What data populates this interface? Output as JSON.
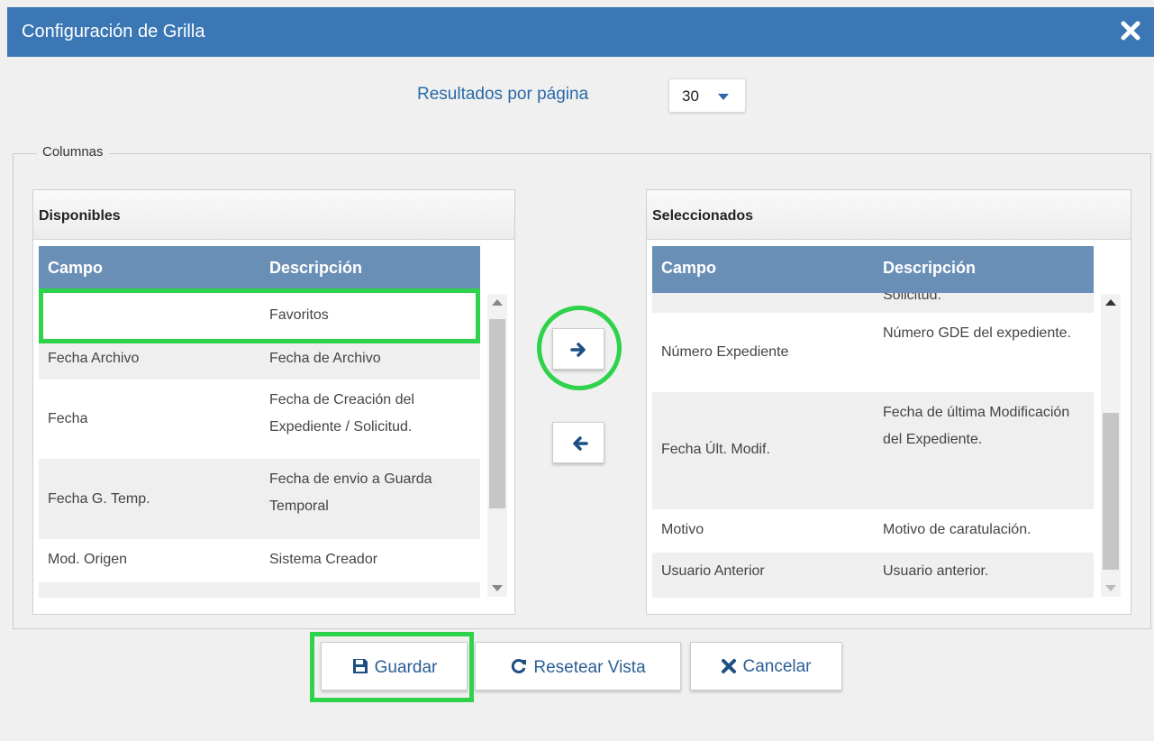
{
  "dialog": {
    "title": "Configuración de Grilla",
    "close_icon": "close-icon"
  },
  "results_per_page": {
    "label": "Resultados por página",
    "value": "30"
  },
  "columns": {
    "legend": "Columnas",
    "available": {
      "title": "Disponibles",
      "headers": [
        "Campo",
        "Descripción"
      ],
      "rows": [
        {
          "campo": "",
          "descripcion": "Favoritos"
        },
        {
          "campo": "Fecha Archivo",
          "descripcion": "Fecha de Archivo"
        },
        {
          "campo": "Fecha",
          "descripcion": "Fecha de Creación del Expediente / Solicitud."
        },
        {
          "campo": "Fecha G. Temp.",
          "descripcion": "Fecha de envio a Guarda Temporal"
        },
        {
          "campo": "Mod. Origen",
          "descripcion": "Sistema Creador"
        }
      ]
    },
    "selected": {
      "title": "Seleccionados",
      "headers": [
        "Campo",
        "Descripción"
      ],
      "rows": [
        {
          "campo": "",
          "descripcion": "Solicitud."
        },
        {
          "campo": "Número Expediente",
          "descripcion": "Número GDE del expediente."
        },
        {
          "campo": "Fecha Últ. Modif.",
          "descripcion": "Fecha de última Modificación del Expediente."
        },
        {
          "campo": "Motivo",
          "descripcion": "Motivo de caratulación."
        },
        {
          "campo": "Usuario Anterior",
          "descripcion": "Usuario anterior."
        }
      ]
    }
  },
  "buttons": {
    "save": "Guardar",
    "reset": "Resetear Vista",
    "cancel": "Cancelar"
  },
  "colors": {
    "title_bar": "#3a77b4",
    "grid_header": "#6a8fb7",
    "highlight": "#2fd24b",
    "link_text": "#2a6aa8"
  }
}
